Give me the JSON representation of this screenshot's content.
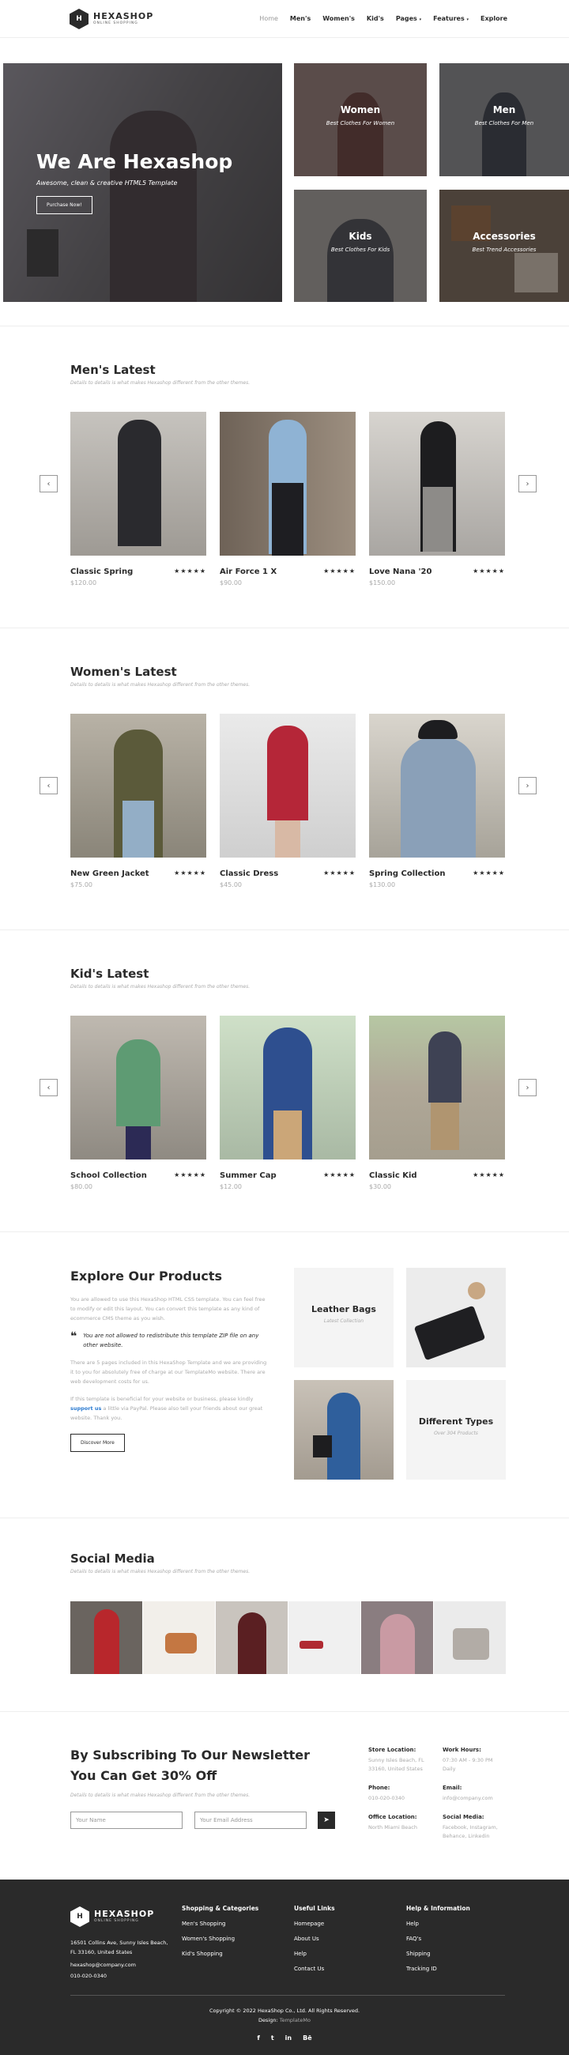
{
  "nav": {
    "brand": "HEXASHOP",
    "brand_sub": "ONLINE SHOPPING",
    "logo_letter": "H",
    "items": [
      "Home",
      "Men's",
      "Women's",
      "Kid's",
      "Pages",
      "Features",
      "Explore"
    ],
    "active": "Home"
  },
  "hero": {
    "title": "We Are Hexashop",
    "subtitle": "Awesome, clean & creative HTML5 Template",
    "button": "Purchase Now!",
    "categories": [
      {
        "title": "Women",
        "sub": "Best Clothes For Women"
      },
      {
        "title": "Men",
        "sub": "Best Clothes For Men"
      },
      {
        "title": "Kids",
        "sub": "Best Clothes For Kids"
      },
      {
        "title": "Accessories",
        "sub": "Best Trend Accessories"
      }
    ]
  },
  "mens": {
    "title": "Men's Latest",
    "sub": "Details to details is what makes Hexashop different from the other themes.",
    "products": [
      {
        "name": "Classic Spring",
        "price": "$120.00"
      },
      {
        "name": "Air Force 1 X",
        "price": "$90.00"
      },
      {
        "name": "Love Nana '20",
        "price": "$150.00"
      }
    ]
  },
  "womens": {
    "title": "Women's Latest",
    "sub": "Details to details is what makes Hexashop different from the other themes.",
    "products": [
      {
        "name": "New Green Jacket",
        "price": "$75.00"
      },
      {
        "name": "Classic Dress",
        "price": "$45.00"
      },
      {
        "name": "Spring Collection",
        "price": "$130.00"
      }
    ]
  },
  "kids": {
    "title": "Kid's Latest",
    "sub": "Details to details is what makes Hexashop different from the other themes.",
    "products": [
      {
        "name": "School Collection",
        "price": "$80.00"
      },
      {
        "name": "Summer Cap",
        "price": "$12.00"
      },
      {
        "name": "Classic Kid",
        "price": "$30.00"
      }
    ]
  },
  "stars": "★★★★★",
  "arrows": {
    "prev": "‹",
    "next": "›"
  },
  "explore": {
    "title": "Explore Our Products",
    "p1": "You are allowed to use this HexaShop HTML CSS template. You can feel free to modify or edit this layout. You can convert this template as any kind of ecommerce CMS theme as you wish.",
    "quote": "You are not allowed to redistribute this template ZIP file on any other website.",
    "quote_mark": "❝",
    "p2": "There are 5 pages included in this HexaShop Template and we are providing it to you for absolutely free of charge at our TemplateMo website. There are web development costs for us.",
    "p3_a": "If this template is beneficial for your website or business, please kindly ",
    "p3_link": "support us",
    "p3_b": " a little via PayPal. Please also tell your friends about our great website. Thank you.",
    "button": "Discover More",
    "boxes": [
      {
        "title": "Leather Bags",
        "sub": "Latest Collection"
      },
      {
        "title": "Different Types",
        "sub": "Over 304 Products"
      }
    ]
  },
  "social": {
    "title": "Social Media",
    "sub": "Details to details is what makes Hexashop different from the other themes."
  },
  "newsletter": {
    "title": "By Subscribing To Our Newsletter You Can Get 30% Off",
    "sub": "Details to details is what makes Hexashop different from the other themes.",
    "name_placeholder": "Your Name",
    "email_placeholder": "Your Email Address",
    "send_icon": "➤",
    "info": [
      {
        "label": "Store Location:",
        "value": "Sunny Isles Beach, FL 33160, United States"
      },
      {
        "label": "Work Hours:",
        "value": "07:30 AM - 9:30 PM Daily"
      },
      {
        "label": "Phone:",
        "value": "010-020-0340"
      },
      {
        "label": "Email:",
        "value": "info@company.com"
      },
      {
        "label": "Office Location:",
        "value": "North Miami Beach"
      },
      {
        "label": "Social Media:",
        "value": "Facebook, Instagram, Behance, Linkedin"
      }
    ]
  },
  "footer": {
    "address": "16501 Collins Ave, Sunny Isles Beach, FL 33160, United States",
    "email": "hexashop@company.com",
    "phone": "010-020-0340",
    "cols": [
      {
        "title": "Shopping & Categories",
        "items": [
          "Men's Shopping",
          "Women's Shopping",
          "Kid's Shopping"
        ]
      },
      {
        "title": "Useful Links",
        "items": [
          "Homepage",
          "About Us",
          "Help",
          "Contact Us"
        ]
      },
      {
        "title": "Help & Information",
        "items": [
          "Help",
          "FAQ's",
          "Shipping",
          "Tracking ID"
        ]
      }
    ],
    "copyright": "Copyright © 2022 HexaShop Co., Ltd. All Rights Reserved.",
    "design_label": "Design: ",
    "design_link": "TemplateMo",
    "social_icons": [
      "f",
      "t",
      "in",
      "Bē"
    ]
  },
  "colors": {
    "dark": "#2a2a2a",
    "muted": "#aaaaaa",
    "link": "#2a7ad0"
  }
}
